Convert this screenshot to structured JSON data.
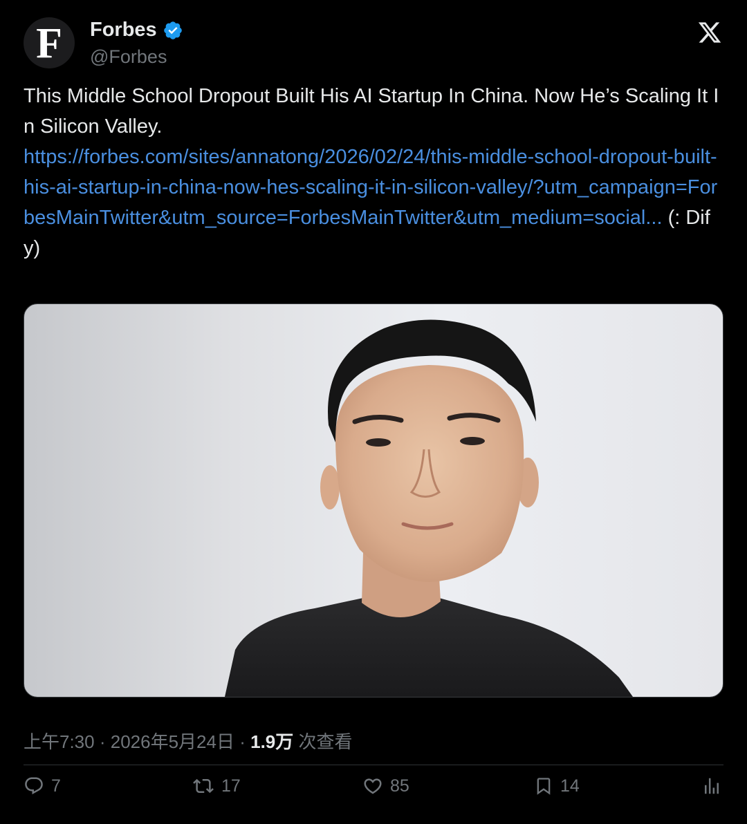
{
  "app": {
    "brand": "X"
  },
  "account": {
    "avatar_letter": "F",
    "display_name": "Forbes",
    "handle": "@Forbes",
    "verified_color": "#1d9bf0"
  },
  "tweet": {
    "text": "This Middle School Dropout Built His AI Startup In China. Now He’s Scaling It In Silicon Valley.",
    "link": "https://forbes.com/sites/annatong/2026/02/24/this-middle-school-dropout-built-his-ai-startup-in-china-now-hes-scaling-it-in-silicon-valley/?utm_campaign=ForbesMainTwitter&utm_source=ForbesMainTwitter&utm_medium=social...",
    "suffix": "(: Dify)",
    "link_color": "#4a8fe0"
  },
  "media": {
    "alt": "Portrait of a man in a black t-shirt against a light grey background"
  },
  "meta": {
    "time": "上午7:30",
    "separator": "·",
    "date": "2026年5月24日",
    "views_count": "1.9万",
    "views_label": "次查看"
  },
  "actions": {
    "replies": {
      "icon": "reply-icon",
      "count": "7"
    },
    "reposts": {
      "icon": "repost-icon",
      "count": "17"
    },
    "likes": {
      "icon": "heart-icon",
      "count": "85"
    },
    "bookmarks": {
      "icon": "bookmark-icon",
      "count": "14"
    },
    "analytics": {
      "icon": "analytics-icon"
    }
  }
}
